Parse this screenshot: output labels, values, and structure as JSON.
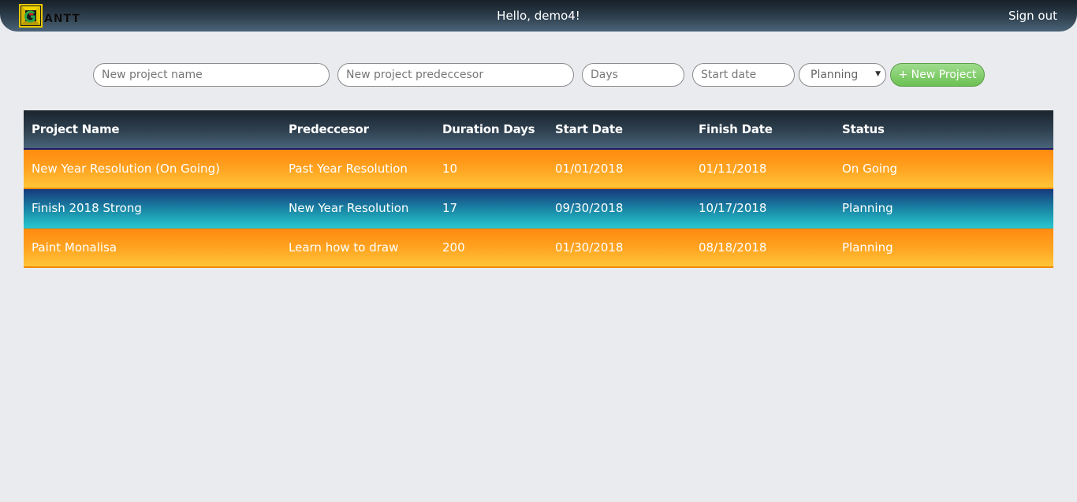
{
  "header": {
    "logo_text": "ANTT",
    "greeting": "Hello, demo4!",
    "signout_label": "Sign out"
  },
  "form": {
    "name_placeholder": "New project name",
    "predecessor_placeholder": "New project predeccesor",
    "days_placeholder": "Days",
    "start_placeholder": "Start date",
    "status_selected": "Planning",
    "new_button_label": "+ New Project"
  },
  "table": {
    "columns": [
      "Project Name",
      "Predeccesor",
      "Duration Days",
      "Start Date",
      "Finish Date",
      "Status"
    ],
    "rows": [
      [
        "New Year Resolution (On Going)",
        "Past Year Resolution",
        "10",
        "01/01/2018",
        "01/11/2018",
        "On Going"
      ],
      [
        "Finish 2018 Strong",
        "New Year Resolution",
        "17",
        "09/30/2018",
        "10/17/2018",
        "Planning"
      ],
      [
        "Paint Monalisa",
        "Learn how to draw",
        "200",
        "01/30/2018",
        "08/18/2018",
        "Planning"
      ]
    ]
  },
  "colors": {
    "header_bar": "#2a3a48",
    "row_orange": "#ffa320",
    "row_blue": "#1a8aa8",
    "button_green": "#6cc153",
    "background": "#eaebef"
  }
}
